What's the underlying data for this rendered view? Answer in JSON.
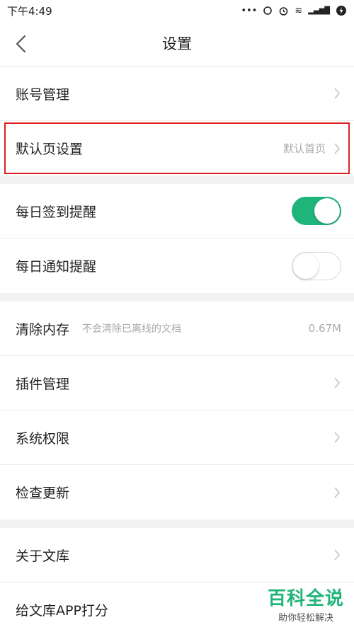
{
  "status": {
    "time": "下午4:49",
    "dots": "•••",
    "wifi": "≋",
    "signal": "▂▄▆█"
  },
  "header": {
    "title": "设置"
  },
  "sections": [
    {
      "items": [
        {
          "label": "账号管理"
        },
        {
          "label": "默认页设置",
          "value": "默认首页"
        }
      ]
    },
    {
      "items": [
        {
          "label": "每日签到提醒",
          "toggle": "on"
        },
        {
          "label": "每日通知提醒",
          "toggle": "off"
        }
      ]
    },
    {
      "items": [
        {
          "label": "清除内存",
          "desc": "不会清除已离线的文档",
          "value": "0.67M"
        },
        {
          "label": "插件管理"
        },
        {
          "label": "系统权限"
        },
        {
          "label": "检查更新"
        }
      ]
    },
    {
      "items": [
        {
          "label": "关于文库"
        },
        {
          "label": "给文库APP打分"
        }
      ]
    }
  ],
  "watermark": {
    "title": "百科全说",
    "subtitle": "助你轻松解决"
  },
  "colors": {
    "accent": "#1fb57a",
    "highlight": "#e02020"
  }
}
